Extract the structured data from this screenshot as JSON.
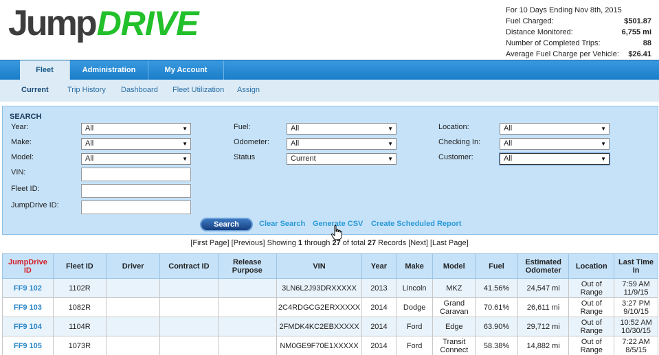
{
  "logo": {
    "part1": "Jump",
    "part2": "DRIVE"
  },
  "summary": {
    "period": "For 10 Days Ending Nov 8th, 2015",
    "rows": [
      {
        "label": "Fuel Charged:",
        "value": "$501.87"
      },
      {
        "label": "Distance Monitored:",
        "value": "6,755 mi"
      },
      {
        "label": "Number of Completed Trips:",
        "value": "88"
      },
      {
        "label": "Average Fuel Charge per Vehicle:",
        "value": "$26.41"
      }
    ]
  },
  "nav": {
    "tabs": [
      {
        "label": "Fleet"
      },
      {
        "label": "Administration"
      },
      {
        "label": "My Account"
      }
    ],
    "subtabs": [
      {
        "label": "Current"
      },
      {
        "label": "Trip History"
      },
      {
        "label": "Dashboard"
      },
      {
        "label": "Fleet Utilization"
      },
      {
        "label": "Assign"
      }
    ]
  },
  "search": {
    "title": "SEARCH",
    "fields": {
      "year": {
        "label": "Year:",
        "value": "All"
      },
      "make": {
        "label": "Make:",
        "value": "All"
      },
      "model": {
        "label": "Model:",
        "value": "All"
      },
      "vin": {
        "label": "VIN:",
        "value": ""
      },
      "fleet_id": {
        "label": "Fleet ID:",
        "value": ""
      },
      "jumpdrive_id": {
        "label": "JumpDrive ID:",
        "value": ""
      },
      "fuel": {
        "label": "Fuel:",
        "value": "All"
      },
      "odometer": {
        "label": "Odometer:",
        "value": "All"
      },
      "status": {
        "label": "Status",
        "value": "Current"
      },
      "location": {
        "label": "Location:",
        "value": "All"
      },
      "checking_in": {
        "label": "Checking In:",
        "value": "All"
      },
      "customer": {
        "label": "Customer:",
        "value": "All"
      }
    },
    "search_button": "Search",
    "clear_link": "Clear Search",
    "csv_link": "Generate CSV",
    "report_link": "Create Scheduled Report"
  },
  "pager": {
    "first": "[First Page]",
    "previous": "[Previous]",
    "showing": "Showing",
    "from": "1",
    "through": "through",
    "to": "27",
    "of_total": "of total",
    "total": "27",
    "records": "Records",
    "next": "[Next]",
    "last": "[Last Page]"
  },
  "table": {
    "headers": [
      "JumpDrive ID",
      "Fleet ID",
      "Driver",
      "Contract ID",
      "Release Purpose",
      "VIN",
      "Year",
      "Make",
      "Model",
      "Fuel",
      "Estimated Odometer",
      "Location",
      "Last Time In"
    ],
    "rows": [
      {
        "jumpdrive_id": "FF9 102",
        "fleet_id": "1102R",
        "driver": "",
        "contract_id": "",
        "release_purpose": "",
        "vin": "3LN6L2J93DRXXXXX",
        "year": "2013",
        "make": "Lincoln",
        "model": "MKZ",
        "fuel": "41.56%",
        "odometer": "24,547 mi",
        "location": "Out of Range",
        "last_time": "7:59 AM",
        "last_date": "11/9/15"
      },
      {
        "jumpdrive_id": "FF9 103",
        "fleet_id": "1082R",
        "driver": "",
        "contract_id": "",
        "release_purpose": "",
        "vin": "2C4RDGCG2ERXXXXX",
        "year": "2014",
        "make": "Dodge",
        "model": "Grand Caravan",
        "fuel": "70.61%",
        "odometer": "26,611 mi",
        "location": "Out of Range",
        "last_time": "3:27 PM",
        "last_date": "9/10/15"
      },
      {
        "jumpdrive_id": "FF9 104",
        "fleet_id": "1104R",
        "driver": "",
        "contract_id": "",
        "release_purpose": "",
        "vin": "2FMDK4KC2EBXXXXX",
        "year": "2014",
        "make": "Ford",
        "model": "Edge",
        "fuel": "63.90%",
        "odometer": "29,712 mi",
        "location": "Out of Range",
        "last_time": "10:52 AM",
        "last_date": "10/30/15"
      },
      {
        "jumpdrive_id": "FF9 105",
        "fleet_id": "1073R",
        "driver": "",
        "contract_id": "",
        "release_purpose": "",
        "vin": "NM0GE9F70E1XXXXX",
        "year": "2014",
        "make": "Ford",
        "model": "Transit Connect",
        "fuel": "58.38%",
        "odometer": "14,882 mi",
        "location": "Out of Range",
        "last_time": "7:22 AM",
        "last_date": "8/5/15"
      }
    ]
  },
  "colors": {
    "brand_green": "#22c02a",
    "nav_blue": "#1a7dc8",
    "panel_blue": "#c6e2f8",
    "header_red": "#d4202a",
    "link_blue": "#2a9ad8"
  },
  "icons": {
    "pointer": "hand-pointer-icon"
  }
}
